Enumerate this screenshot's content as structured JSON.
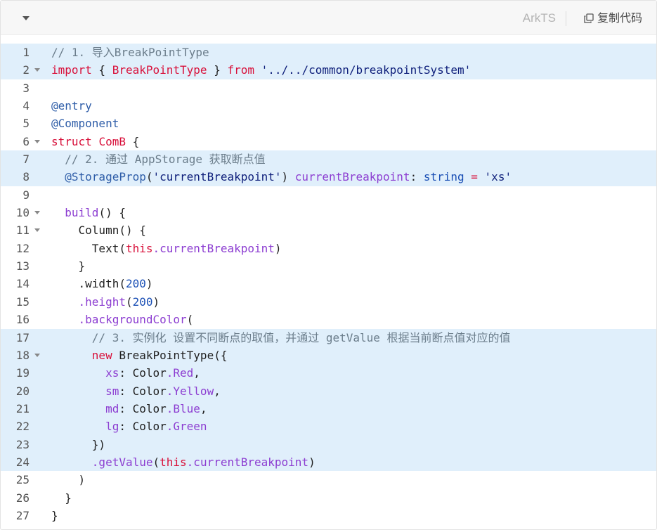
{
  "toolbar": {
    "language": "ArkTS",
    "copy_label": "复制代码",
    "collapse_icon": "chevron-down-icon",
    "copy_icon": "copy-icon"
  },
  "code": {
    "lines": [
      {
        "n": "1",
        "hl": true,
        "fold": false,
        "tokens": [
          [
            "c",
            "// 1. 导入BreakPointType"
          ]
        ]
      },
      {
        "n": "2",
        "hl": true,
        "fold": true,
        "tokens": [
          [
            "k",
            "import"
          ],
          [
            "p",
            " { "
          ],
          [
            "k",
            "BreakPointType"
          ],
          [
            "p",
            " } "
          ],
          [
            "k",
            "from"
          ],
          [
            "p",
            " "
          ],
          [
            "s",
            "'../../common/breakpointSystem'"
          ]
        ]
      },
      {
        "n": "3",
        "hl": false,
        "fold": false,
        "tokens": []
      },
      {
        "n": "4",
        "hl": false,
        "fold": false,
        "tokens": [
          [
            "d",
            "@entry"
          ]
        ]
      },
      {
        "n": "5",
        "hl": false,
        "fold": false,
        "tokens": [
          [
            "d",
            "@Component"
          ]
        ]
      },
      {
        "n": "6",
        "hl": false,
        "fold": true,
        "tokens": [
          [
            "k",
            "struct"
          ],
          [
            "p",
            " "
          ],
          [
            "k",
            "ComB"
          ],
          [
            "p",
            " {"
          ]
        ]
      },
      {
        "n": "7",
        "hl": true,
        "fold": false,
        "tokens": [
          [
            "p",
            "  "
          ],
          [
            "c",
            "// 2. 通过 AppStorage 获取断点值"
          ]
        ]
      },
      {
        "n": "8",
        "hl": true,
        "fold": false,
        "tokens": [
          [
            "p",
            "  "
          ],
          [
            "d",
            "@StorageProp"
          ],
          [
            "p",
            "("
          ],
          [
            "s",
            "'currentBreakpoint'"
          ],
          [
            "p",
            ") "
          ],
          [
            "f",
            "currentBreakpoint"
          ],
          [
            "p",
            ": "
          ],
          [
            "n",
            "string"
          ],
          [
            "p",
            " "
          ],
          [
            "k",
            "="
          ],
          [
            "p",
            " "
          ],
          [
            "s",
            "'xs'"
          ]
        ]
      },
      {
        "n": "9",
        "hl": false,
        "fold": false,
        "tokens": []
      },
      {
        "n": "10",
        "hl": false,
        "fold": true,
        "tokens": [
          [
            "p",
            "  "
          ],
          [
            "f",
            "build"
          ],
          [
            "p",
            "() {"
          ]
        ]
      },
      {
        "n": "11",
        "hl": false,
        "fold": true,
        "tokens": [
          [
            "p",
            "    Column() {"
          ]
        ]
      },
      {
        "n": "12",
        "hl": false,
        "fold": false,
        "tokens": [
          [
            "p",
            "      Text("
          ],
          [
            "k",
            "this"
          ],
          [
            "f",
            ".currentBreakpoint"
          ],
          [
            "p",
            ")"
          ]
        ]
      },
      {
        "n": "13",
        "hl": false,
        "fold": false,
        "tokens": [
          [
            "p",
            "    }"
          ]
        ]
      },
      {
        "n": "14",
        "hl": false,
        "fold": false,
        "tokens": [
          [
            "p",
            "    .width("
          ],
          [
            "n",
            "200"
          ],
          [
            "p",
            ")"
          ]
        ]
      },
      {
        "n": "15",
        "hl": false,
        "fold": false,
        "tokens": [
          [
            "p",
            "    "
          ],
          [
            "f",
            ".height"
          ],
          [
            "p",
            "("
          ],
          [
            "n",
            "200"
          ],
          [
            "p",
            ")"
          ]
        ]
      },
      {
        "n": "16",
        "hl": false,
        "fold": false,
        "tokens": [
          [
            "p",
            "    "
          ],
          [
            "f",
            ".backgroundColor"
          ],
          [
            "p",
            "("
          ]
        ]
      },
      {
        "n": "17",
        "hl": true,
        "fold": false,
        "tokens": [
          [
            "p",
            "      "
          ],
          [
            "c",
            "// 3. 实例化 设置不同断点的取值，并通过 getValue 根据当前断点值对应的值"
          ]
        ]
      },
      {
        "n": "18",
        "hl": true,
        "fold": true,
        "tokens": [
          [
            "p",
            "      "
          ],
          [
            "k",
            "new"
          ],
          [
            "p",
            " BreakPointType({"
          ]
        ]
      },
      {
        "n": "19",
        "hl": true,
        "fold": false,
        "tokens": [
          [
            "p",
            "        "
          ],
          [
            "f",
            "xs"
          ],
          [
            "p",
            ": Color"
          ],
          [
            "f",
            ".Red"
          ],
          [
            "p",
            ","
          ]
        ]
      },
      {
        "n": "20",
        "hl": true,
        "fold": false,
        "tokens": [
          [
            "p",
            "        "
          ],
          [
            "f",
            "sm"
          ],
          [
            "p",
            ": Color"
          ],
          [
            "f",
            ".Yellow"
          ],
          [
            "p",
            ","
          ]
        ]
      },
      {
        "n": "21",
        "hl": true,
        "fold": false,
        "tokens": [
          [
            "p",
            "        "
          ],
          [
            "f",
            "md"
          ],
          [
            "p",
            ": Color"
          ],
          [
            "f",
            ".Blue"
          ],
          [
            "p",
            ","
          ]
        ]
      },
      {
        "n": "22",
        "hl": true,
        "fold": false,
        "tokens": [
          [
            "p",
            "        "
          ],
          [
            "f",
            "lg"
          ],
          [
            "p",
            ": Color"
          ],
          [
            "f",
            ".Green"
          ]
        ]
      },
      {
        "n": "23",
        "hl": true,
        "fold": false,
        "tokens": [
          [
            "p",
            "      })"
          ]
        ]
      },
      {
        "n": "24",
        "hl": true,
        "fold": false,
        "tokens": [
          [
            "p",
            "      "
          ],
          [
            "f",
            ".getValue"
          ],
          [
            "p",
            "("
          ],
          [
            "k",
            "this"
          ],
          [
            "f",
            ".currentBreakpoint"
          ],
          [
            "p",
            ")"
          ]
        ]
      },
      {
        "n": "25",
        "hl": false,
        "fold": false,
        "tokens": [
          [
            "p",
            "    )"
          ]
        ]
      },
      {
        "n": "26",
        "hl": false,
        "fold": false,
        "tokens": [
          [
            "p",
            "  }"
          ]
        ]
      },
      {
        "n": "27",
        "hl": false,
        "fold": false,
        "tokens": [
          [
            "p",
            "}"
          ]
        ]
      }
    ]
  }
}
